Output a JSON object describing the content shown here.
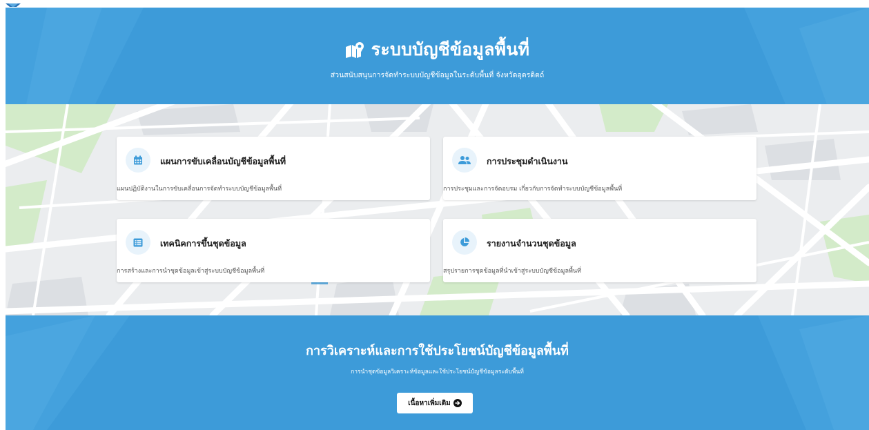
{
  "hero": {
    "title": "ระบบบัญชีข้อมูลพื้นที่",
    "subtitle": "ส่วนสนับสนุนการจัดทำระบบบัญชีข้อมูลในระดับพื้นที่ จังหวัดอุตรดิตถ์",
    "icon": "map-marker-icon"
  },
  "cards": [
    {
      "title": "แผนการขับเคลื่อนบัญชีข้อมูลพื้นที่",
      "desc": "แผนปฏิบัติงานในการขับเคลื่อนการจัดทำระบบบัญชีข้อมูลพื้นที่",
      "icon": "calendar-icon"
    },
    {
      "title": "การประชุมดำเนินงาน",
      "desc": "การประชุมและการจัดอบรม เกี่ยวกับการจัดทำระบบบัญชีข้อมูลพื้นที่",
      "icon": "users-icon"
    },
    {
      "title": "เทคนิคการขึ้นชุดข้อมูล",
      "desc": "การสร้างและการนำชุดข้อมูลเข้าสู่ระบบบัญชีข้อมูลพื้นที่",
      "icon": "list-icon"
    },
    {
      "title": "รายงานจำนวนชุดข้อมูล",
      "desc": "สรุปรายการชุดข้อมูลที่นำเข้าสู่ระบบบัญชีข้อมูลพื้นที่",
      "icon": "pie-chart-icon"
    }
  ],
  "analysis": {
    "title": "การวิเคราะห์และการใช้ประโยชน์บัญชีข้อมูลพื้นที่",
    "subtitle": "การนำชุดข้อมูลวิเคราะห์ข้อมูลและใช้ประโยชน์บัญชีข้อมูลระดับพื้นที่",
    "button_label": "เนื้อหาเพิ่มเติม",
    "button_icon": "arrow-circle-right-icon"
  },
  "colors": {
    "primary": "#3d9bd9",
    "icon_bg": "#e8f3fb",
    "icon_fg": "#3d9bd9"
  }
}
